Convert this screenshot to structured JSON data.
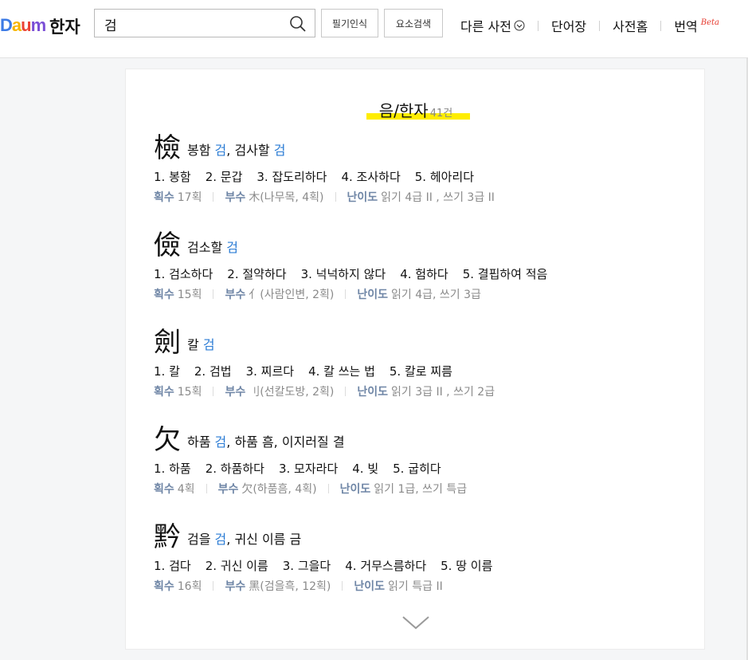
{
  "header": {
    "logo_text": "Daum",
    "service": "한자",
    "search_value": "검",
    "handwriting_btn": "필기인식",
    "component_btn": "요소검색",
    "nav": {
      "other_dict": "다른 사전",
      "wordbook": "단어장",
      "dict_home": "사전홈",
      "translate": "번역",
      "beta": "Beta"
    }
  },
  "section": {
    "title": "음/한자",
    "count": "41건"
  },
  "entries": [
    {
      "hanja": "檢",
      "reading": [
        {
          "t": "봉함 "
        },
        {
          "t": "검",
          "hl": true
        },
        {
          "t": ", 검사할 "
        },
        {
          "t": "검",
          "hl": true
        }
      ],
      "meanings": [
        "1. 봉함",
        "2. 문갑",
        "3. 잡도리하다",
        "4. 조사하다",
        "5. 헤아리다"
      ],
      "strokes_label": "획수",
      "strokes": "17획",
      "radical_label": "부수",
      "radical": "木(나무목, 4획)",
      "level_label": "난이도",
      "level": "읽기 4급 II , 쓰기 3급 II"
    },
    {
      "hanja": "儉",
      "reading": [
        {
          "t": "검소할 "
        },
        {
          "t": "검",
          "hl": true
        }
      ],
      "meanings": [
        "1. 검소하다",
        "2. 절약하다",
        "3. 넉넉하지 않다",
        "4. 험하다",
        "5. 결핍하여 적음"
      ],
      "strokes_label": "획수",
      "strokes": "15획",
      "radical_label": "부수",
      "radical": "亻(사람인변, 2획)",
      "level_label": "난이도",
      "level": "읽기 4급, 쓰기 3급"
    },
    {
      "hanja": "劍",
      "reading": [
        {
          "t": "칼 "
        },
        {
          "t": "검",
          "hl": true
        }
      ],
      "meanings": [
        "1. 칼",
        "2. 검법",
        "3. 찌르다",
        "4. 칼 쓰는 법",
        "5. 칼로 찌름"
      ],
      "strokes_label": "획수",
      "strokes": "15획",
      "radical_label": "부수",
      "radical": "刂(선칼도방, 2획)",
      "level_label": "난이도",
      "level": "읽기 3급 II , 쓰기 2급"
    },
    {
      "hanja": "欠",
      "reading": [
        {
          "t": "하품 "
        },
        {
          "t": "검",
          "hl": true
        },
        {
          "t": ", 하품 흠, 이지러질 결"
        }
      ],
      "meanings": [
        "1. 하품",
        "2. 하품하다",
        "3. 모자라다",
        "4. 빚",
        "5. 굽히다"
      ],
      "strokes_label": "획수",
      "strokes": "4획",
      "radical_label": "부수",
      "radical": "欠(하품흠, 4획)",
      "level_label": "난이도",
      "level": "읽기 1급, 쓰기 특급"
    },
    {
      "hanja": "黔",
      "reading": [
        {
          "t": "검을 "
        },
        {
          "t": "검",
          "hl": true
        },
        {
          "t": ", 귀신 이름 금"
        }
      ],
      "meanings": [
        "1. 검다",
        "2. 귀신 이름",
        "3. 그을다",
        "4. 거무스름하다",
        "5. 땅 이름"
      ],
      "strokes_label": "획수",
      "strokes": "16획",
      "radical_label": "부수",
      "radical": "黑(검을흑, 12획)",
      "level_label": "난이도",
      "level": "읽기 특급 II"
    }
  ],
  "more": {
    "icon": "chevron-down-icon"
  }
}
